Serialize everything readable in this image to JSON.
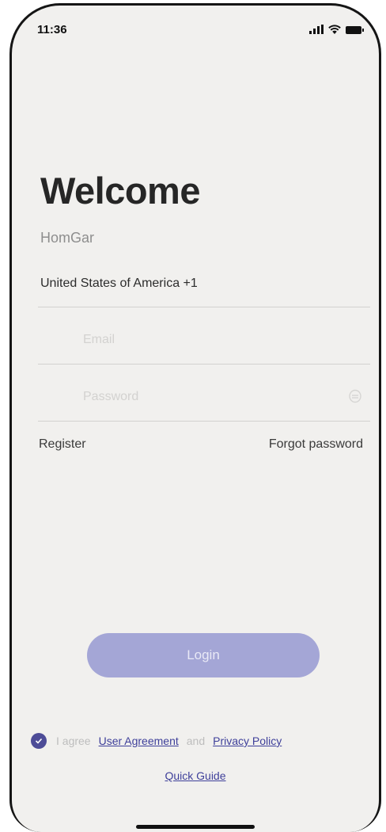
{
  "status_bar": {
    "time": "11:36"
  },
  "header": {
    "title": "Welcome",
    "subtitle": "HomGar"
  },
  "form": {
    "country_label": "United States of America +1",
    "email_placeholder": "Email",
    "password_placeholder": "Password"
  },
  "links": {
    "register": "Register",
    "forgot_password": "Forgot password"
  },
  "login_button": {
    "label": "Login"
  },
  "agreement": {
    "prefix": "I agree",
    "user_agreement": "User Agreement",
    "conjunction": "and",
    "privacy_policy": "Privacy Policy",
    "checked": true
  },
  "quick_guide": "Quick Guide",
  "colors": {
    "accent": "#4d4c97",
    "button_disabled": "#a4a6d6",
    "link": "#3e3f9a",
    "background": "#f1f0ee"
  },
  "icons": {
    "signal": "signal-icon",
    "wifi": "wifi-icon",
    "battery": "battery-icon",
    "password_toggle": "eye-icon",
    "agree_check": "check-icon"
  }
}
